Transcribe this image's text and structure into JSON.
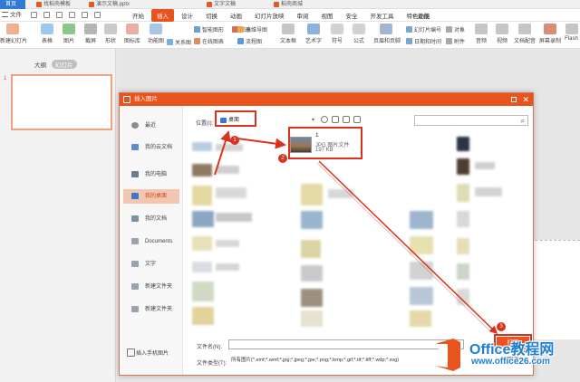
{
  "tabbar": {
    "home": "首页",
    "tabs": [
      "找稻壳模板",
      "演示文稿.pptx",
      "文字文稿",
      "稻壳商城"
    ]
  },
  "menubar": {
    "file": "文件",
    "items": [
      "开始",
      "插入",
      "设计",
      "切换",
      "动画",
      "幻灯片放映",
      "审阅",
      "视图",
      "安全",
      "开发工具",
      "特色功能"
    ],
    "active": "插入",
    "search": "查找"
  },
  "ribbon": {
    "big": [
      "新建幻灯片",
      "表格",
      "图片",
      "截屏",
      "形状",
      "图标库",
      "功能图",
      "关系图"
    ],
    "small_left": [
      "智能图形",
      "图表",
      "在线图表"
    ],
    "small_mid": [
      "思维导图",
      "流程图"
    ],
    "big2": [
      "文本框",
      "艺术字",
      "符号",
      "公式"
    ],
    "small_right": [
      "幻灯片编号",
      "对象",
      "日期和时间",
      "附件"
    ],
    "big3": [
      "页眉和页脚",
      "音频",
      "视频",
      "文档配音",
      "屏幕录制",
      "Flash"
    ]
  },
  "sidepanel": {
    "outline": "大纲",
    "slides": "幻灯片",
    "slide_number": "1"
  },
  "dialog": {
    "title": "插入图片",
    "nav": [
      "最近",
      "我的云文档",
      "我的电脑",
      "我的桌面",
      "我的文档",
      "Documents",
      "文字",
      "新建文件夹",
      "新建文件夹"
    ],
    "nav_active_index": 3,
    "phone_import": "插入手机图片",
    "location_label": "位置(I):",
    "location_value": "桌面",
    "file": {
      "name": "1",
      "type": "JPG 图片文件",
      "size": "197 KB"
    },
    "filename_label": "文件名(N):",
    "filename_value": "",
    "filetype_label": "文件类型(T):",
    "filetype_value": "所有图片(*.emf;*.wmf;*.jpg;*.jpeg;*.jpe;*.png;*.bmp;*.gif;*.tif;*.tiff;*.wdp;*.svg)",
    "open_label": "打开",
    "cancel_label": "取消"
  },
  "annotations": {
    "badges": [
      "1",
      "2",
      "3"
    ],
    "color": "#d8331f"
  },
  "watermark": {
    "title": "Office教程网",
    "url": "www.office26.com"
  },
  "colors": {
    "accent": "#e8541d",
    "nav_active_bg": "#f3c6b1"
  }
}
